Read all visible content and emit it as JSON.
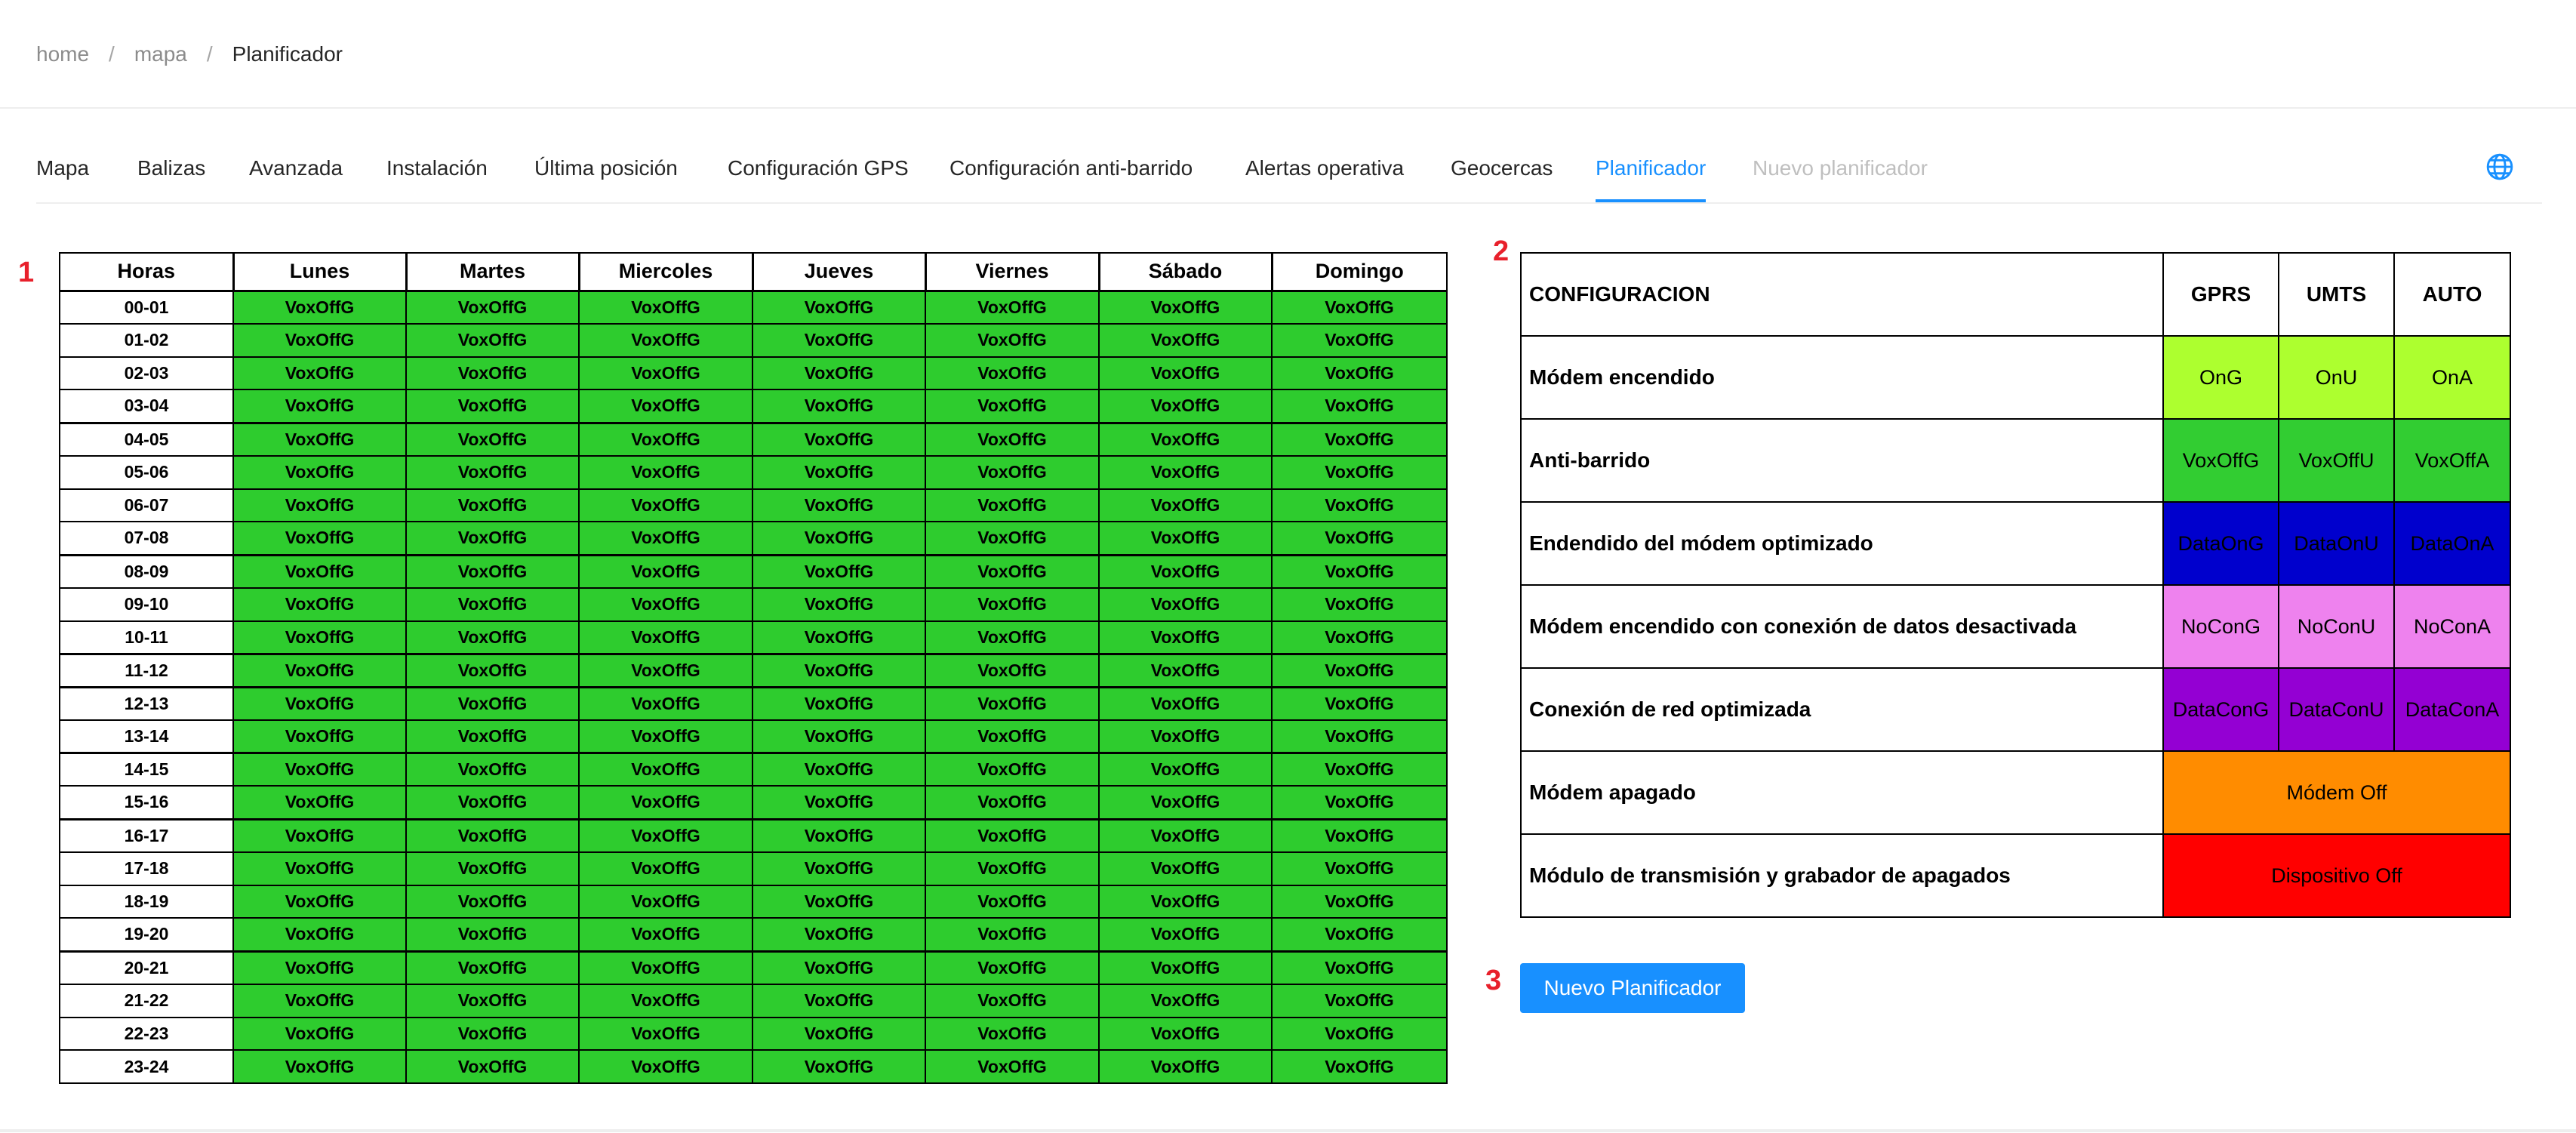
{
  "breadcrumb": [
    "home",
    "mapa",
    "Planificador"
  ],
  "breadcrumb_separator": "/",
  "tabs": [
    {
      "label": "Mapa",
      "state": "normal"
    },
    {
      "label": "Balizas",
      "state": "normal"
    },
    {
      "label": "Avanzada",
      "state": "normal"
    },
    {
      "label": "Instalación",
      "state": "normal"
    },
    {
      "label": "Última posición",
      "state": "normal"
    },
    {
      "label": "Configuración GPS",
      "state": "normal"
    },
    {
      "label": "Configuración anti-barrido",
      "state": "normal"
    },
    {
      "label": "Alertas operativa",
      "state": "normal"
    },
    {
      "label": "Geocercas",
      "state": "normal"
    },
    {
      "label": "Planificador",
      "state": "active"
    },
    {
      "label": "Nuevo planificador",
      "state": "disabled"
    }
  ],
  "language_icon": "globe-icon",
  "markers": {
    "schedule": "1",
    "config": "2",
    "button": "3"
  },
  "schedule": {
    "hour_header": "Horas",
    "days": [
      "Lunes",
      "Martes",
      "Miercoles",
      "Jueves",
      "Viernes",
      "Sábado",
      "Domingo"
    ],
    "hours": [
      "00-01",
      "01-02",
      "02-03",
      "03-04",
      "04-05",
      "05-06",
      "06-07",
      "07-08",
      "08-09",
      "09-10",
      "10-11",
      "11-12",
      "12-13",
      "13-14",
      "14-15",
      "15-16",
      "16-17",
      "17-18",
      "18-19",
      "19-20",
      "20-21",
      "21-22",
      "22-23",
      "23-24"
    ],
    "cell_value": "VoxOffG",
    "cell_color": "#2ecc2e"
  },
  "config": {
    "header": "CONFIGURACION",
    "columns": [
      "GPRS",
      "UMTS",
      "AUTO"
    ],
    "rows": [
      {
        "label": "Módem encendido",
        "values": [
          "OnG",
          "OnU",
          "OnA"
        ],
        "color": "#adff2f"
      },
      {
        "label": "Anti-barrido",
        "values": [
          "VoxOffG",
          "VoxOffU",
          "VoxOffA"
        ],
        "color": "#32cd32"
      },
      {
        "label": "Endendido del módem optimizado",
        "values": [
          "DataOnG",
          "DataOnU",
          "DataOnA"
        ],
        "color": "#0000cd"
      },
      {
        "label": "Módem encendido con conexión de datos desactivada",
        "values": [
          "NoConG",
          "NoConU",
          "NoConA"
        ],
        "color": "#ee82ee"
      },
      {
        "label": "Conexión de red optimizada",
        "values": [
          "DataConG",
          "DataConU",
          "DataConA"
        ],
        "color": "#9400d3"
      },
      {
        "label": "Módem apagado",
        "values": [
          "Módem Off"
        ],
        "color": "#ff8c00"
      },
      {
        "label": "Módulo de transmisión y grabador de apagados",
        "values": [
          "Dispositivo Off"
        ],
        "color": "#ff0000"
      }
    ]
  },
  "new_button_label": "Nuevo Planificador",
  "colors": {
    "accent": "#1890ff",
    "marker": "#e8202b"
  }
}
